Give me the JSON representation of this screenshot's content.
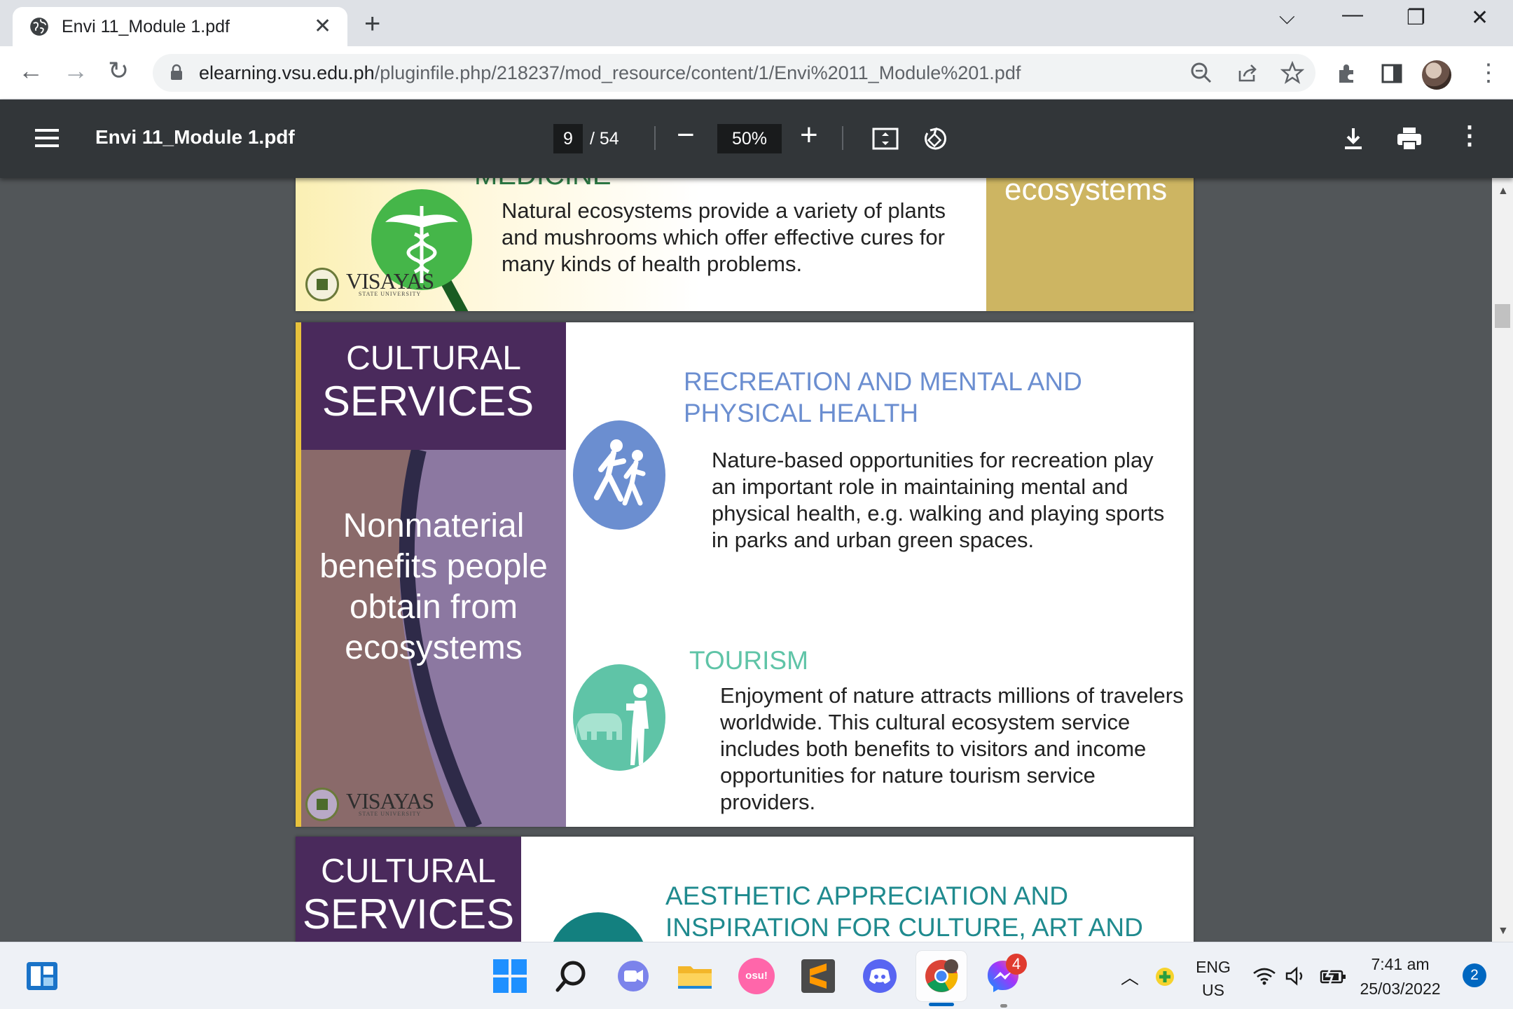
{
  "browser": {
    "tab_title": "Envi 11_Module 1.pdf",
    "url_host": "elearning.vsu.edu.ph",
    "url_path": "/pluginfile.php/218237/mod_resource/content/1/Envi%2011_Module%201.pdf"
  },
  "pdf_toolbar": {
    "title": "Envi 11_Module 1.pdf",
    "page_current": "9",
    "page_total": "/ 54",
    "zoom": "50%"
  },
  "slide1": {
    "heading_partial": "MEDICINE",
    "text": "Natural ecosystems provide a variety of plants and mushrooms which offer effective cures for many kinds of health problems.",
    "side_text": "ecosystems",
    "logo": "VISAYAS",
    "logo_sub": "STATE UNIVERSITY"
  },
  "slide2": {
    "header_line1": "CULTURAL",
    "header_line2": "SERVICES",
    "description": "Nonmaterial benefits people obtain from ecosystems",
    "recreation_title": "RECREATION AND MENTAL AND PHYSICAL HEALTH",
    "recreation_text": "Nature-based opportunities for recreation play an important role in maintaining mental and physical health, e.g. walking and playing sports in parks and urban green spaces.",
    "tourism_title": "TOURISM",
    "tourism_text": "Enjoyment of nature attracts millions of travelers worldwide. This cultural ecosystem service includes both benefits to visitors and income opportunities for nature tourism service providers.",
    "logo": "VISAYAS",
    "logo_sub": "STATE UNIVERSITY"
  },
  "slide3": {
    "header_line1": "CULTURAL",
    "header_line2": "SERVICES",
    "title": "AESTHETIC APPRECIATION AND INSPIRATION FOR CULTURE, ART AND"
  },
  "taskbar": {
    "messenger_badge": "4",
    "osu_label": "osu!",
    "lang_line1": "ENG",
    "lang_line2": "US",
    "time": "7:41 am",
    "date": "25/03/2022",
    "notifications": "2"
  },
  "colors": {
    "pdf_toolbar": "#323639",
    "viewer_bg": "#525659",
    "cultural_purple": "#4a2a5c",
    "recreation_blue": "#6b8ed0",
    "tourism_green": "#5fc4a7",
    "aesthetic_teal": "#1f8a8e"
  }
}
